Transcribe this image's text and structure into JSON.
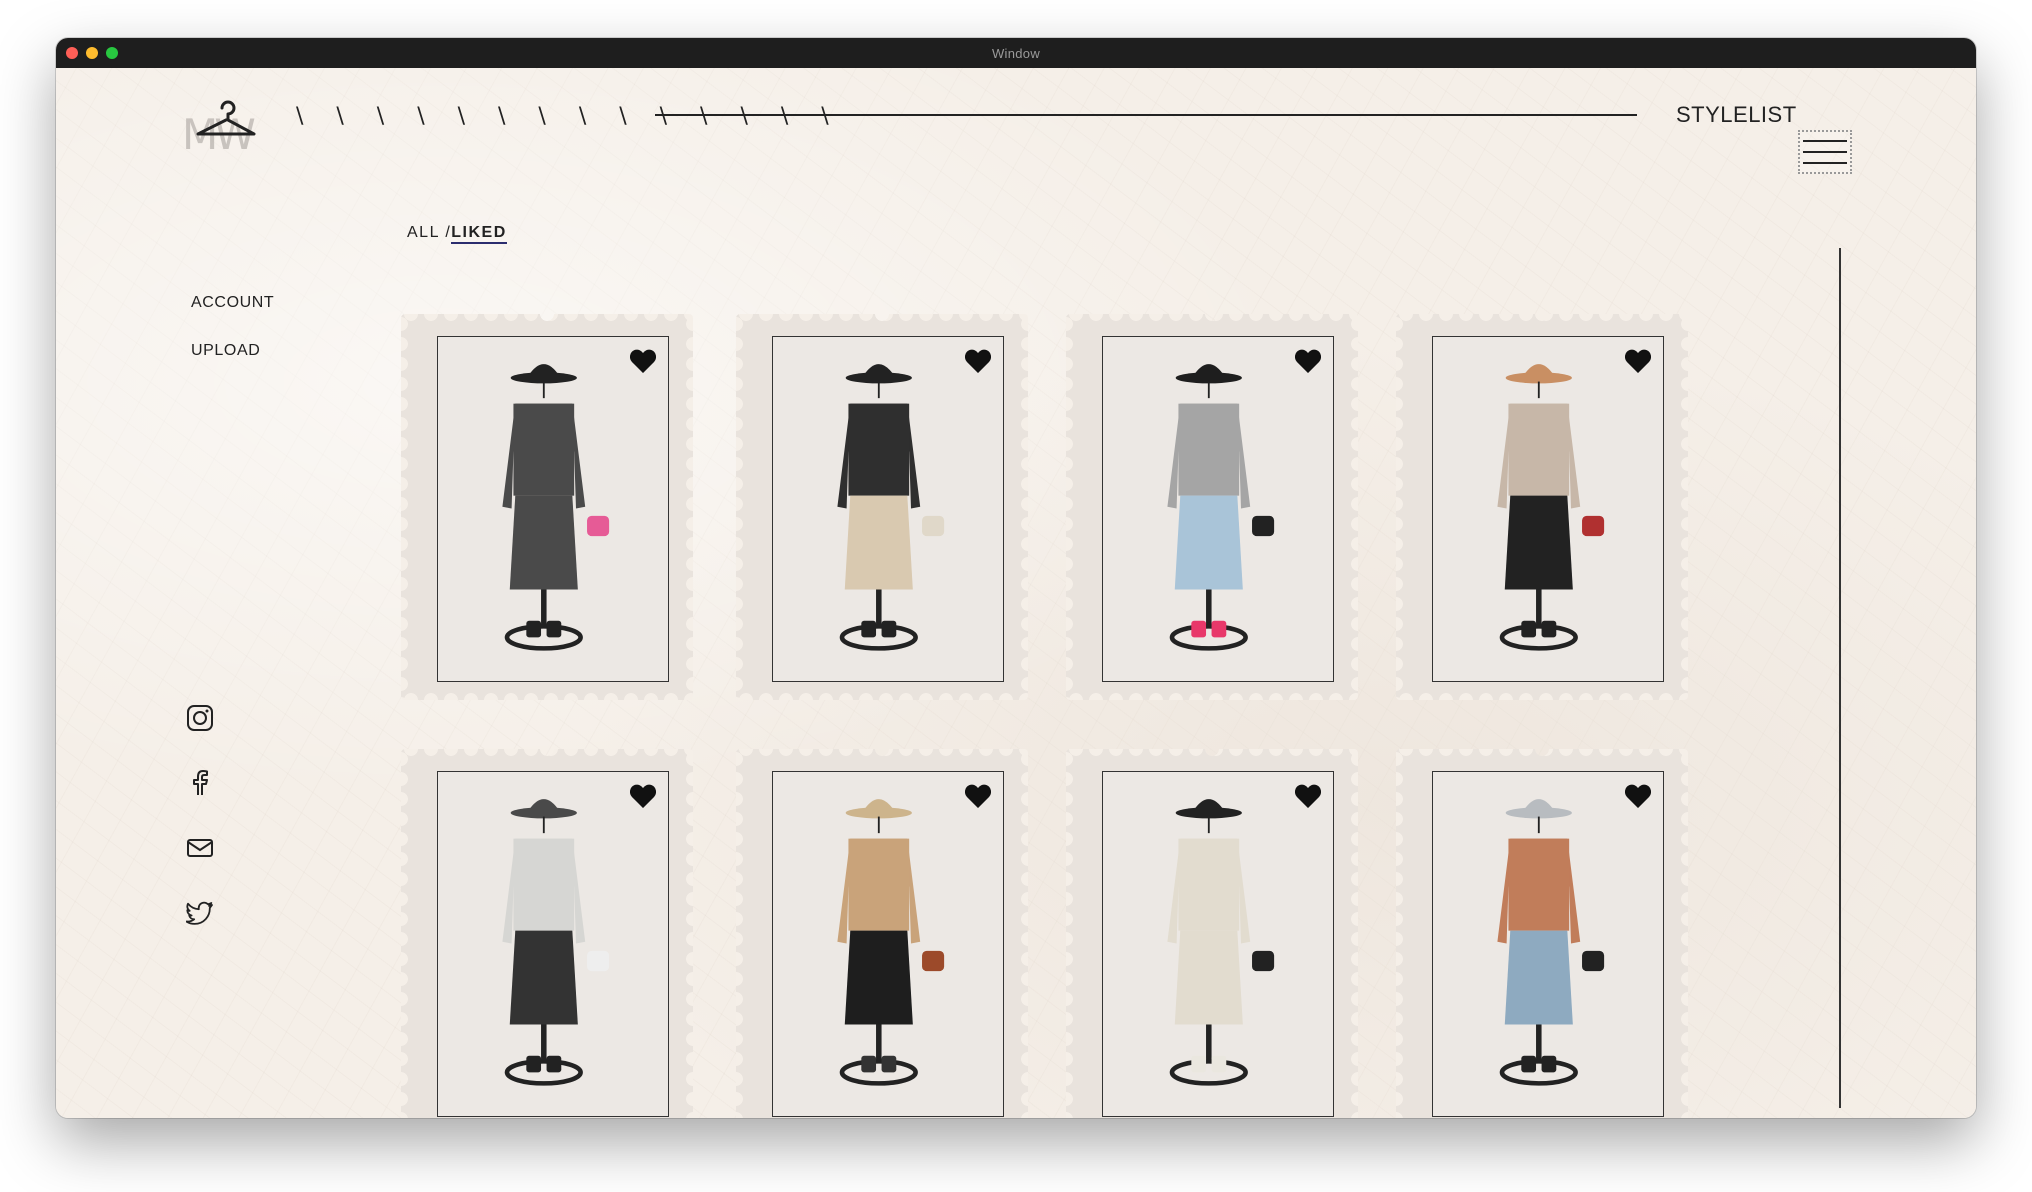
{
  "window": {
    "title": "Window"
  },
  "header": {
    "logo_text": "MW",
    "slashes": "\\ \\ \\ \\ \\ \\ \\ \\ \\ \\ \\ \\ \\ \\",
    "brand": "STYLELIST"
  },
  "filter": {
    "all": "ALL /",
    "liked": "LIKED"
  },
  "side_nav": {
    "account": "ACCOUNT",
    "upload": "UPLOAD"
  },
  "social_icons": [
    "instagram-icon",
    "facebook-icon",
    "mail-icon",
    "twitter-icon"
  ],
  "cards": [
    {
      "liked": true,
      "hat": "#222",
      "top": "#4a4a4a",
      "bottom": "#4a4a4a",
      "shoes": "#222",
      "accent": "#e65b96"
    },
    {
      "liked": true,
      "hat": "#222",
      "top": "#2f2f2f",
      "bottom": "#d9c9b0",
      "shoes": "#222",
      "accent": "#e0d8c9"
    },
    {
      "liked": true,
      "hat": "#1e1e1e",
      "top": "#a5a5a5",
      "bottom": "#a9c4d8",
      "shoes": "#e8386a",
      "accent": "#222"
    },
    {
      "liked": true,
      "hat": "#c98f63",
      "top": "#c7b7a8",
      "bottom": "#222",
      "shoes": "#222",
      "accent": "#b03030"
    },
    {
      "liked": true,
      "hat": "#4a4a4a",
      "top": "#d6d6d3",
      "bottom": "#333",
      "shoes": "#222",
      "accent": "#eee"
    },
    {
      "liked": true,
      "hat": "#cdb48c",
      "top": "#c9a37a",
      "bottom": "#1e1e1e",
      "shoes": "#333",
      "accent": "#9c4a2a"
    },
    {
      "liked": true,
      "hat": "#222",
      "top": "#e2dccf",
      "bottom": "#e2dccf",
      "shoes": "#eae7df",
      "accent": "#222"
    },
    {
      "liked": true,
      "hat": "#b8bcc0",
      "top": "#c17d5a",
      "bottom": "#8eaac0",
      "shoes": "#222",
      "accent": "#222"
    }
  ]
}
